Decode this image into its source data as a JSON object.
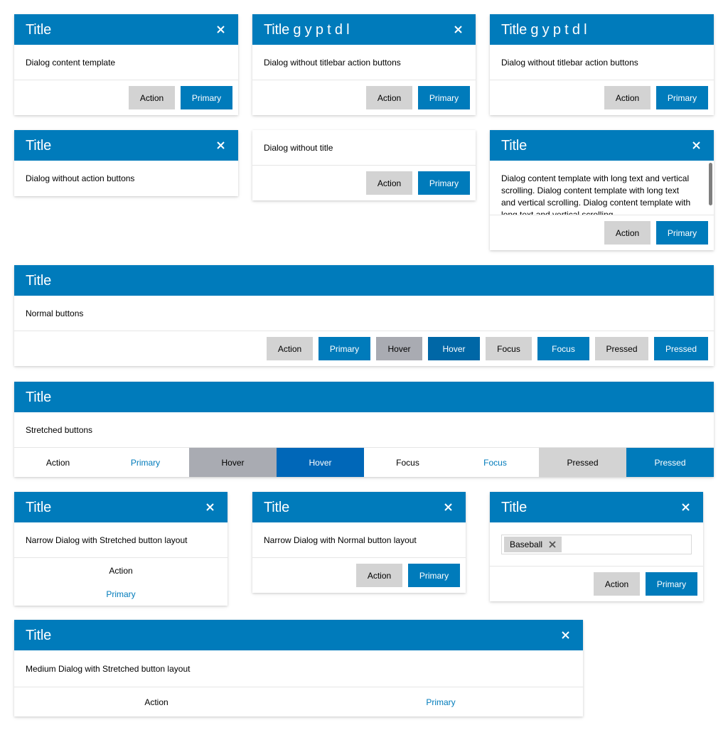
{
  "colors": {
    "accent": "#007bbb",
    "hover_primary": "#0067b8",
    "hover_action": "#a9abb2",
    "action": "#d3d3d3"
  },
  "icons": {
    "close": "close-icon",
    "chip_remove": "close-icon"
  },
  "dialogs": {
    "d1": {
      "title": "Title",
      "content": "Dialog content template",
      "action": "Action",
      "primary": "Primary"
    },
    "d2": {
      "title": "Title g y p t d l",
      "content": "Dialog without titlebar action buttons",
      "action": "Action",
      "primary": "Primary"
    },
    "d3": {
      "title": "Title g y p t d l",
      "content": "Dialog without titlebar action buttons",
      "action": "Action",
      "primary": "Primary"
    },
    "d4": {
      "title": "Title",
      "content": "Dialog without action buttons"
    },
    "d5": {
      "content": "Dialog without title",
      "action": "Action",
      "primary": "Primary"
    },
    "d6": {
      "title": "Title",
      "content": "Dialog content template with long text and vertical scrolling. Dialog content template with long text and vertical scrolling. Dialog content template with long text and vertical scrolling.",
      "action": "Action",
      "primary": "Primary"
    },
    "d7": {
      "title": "Title",
      "content": "Normal buttons",
      "buttons": [
        "Action",
        "Primary",
        "Hover",
        "Hover",
        "Focus",
        "Focus",
        "Pressed",
        "Pressed"
      ]
    },
    "d8": {
      "title": "Title",
      "content": "Stretched buttons",
      "buttons": [
        "Action",
        "Primary",
        "Hover",
        "Hover",
        "Focus",
        "Focus",
        "Pressed",
        "Pressed"
      ]
    },
    "d9": {
      "title": "Title",
      "content": "Narrow Dialog with Stretched button layout",
      "action": "Action",
      "primary": "Primary"
    },
    "d10": {
      "title": "Title",
      "content": "Narrow Dialog with Normal button layout",
      "action": "Action",
      "primary": "Primary"
    },
    "d11": {
      "title": "Title",
      "chip": "Baseball",
      "action": "Action",
      "primary": "Primary"
    },
    "d12": {
      "title": "Title",
      "content": "Medium Dialog with Stretched button layout",
      "action": "Action",
      "primary": "Primary"
    }
  }
}
